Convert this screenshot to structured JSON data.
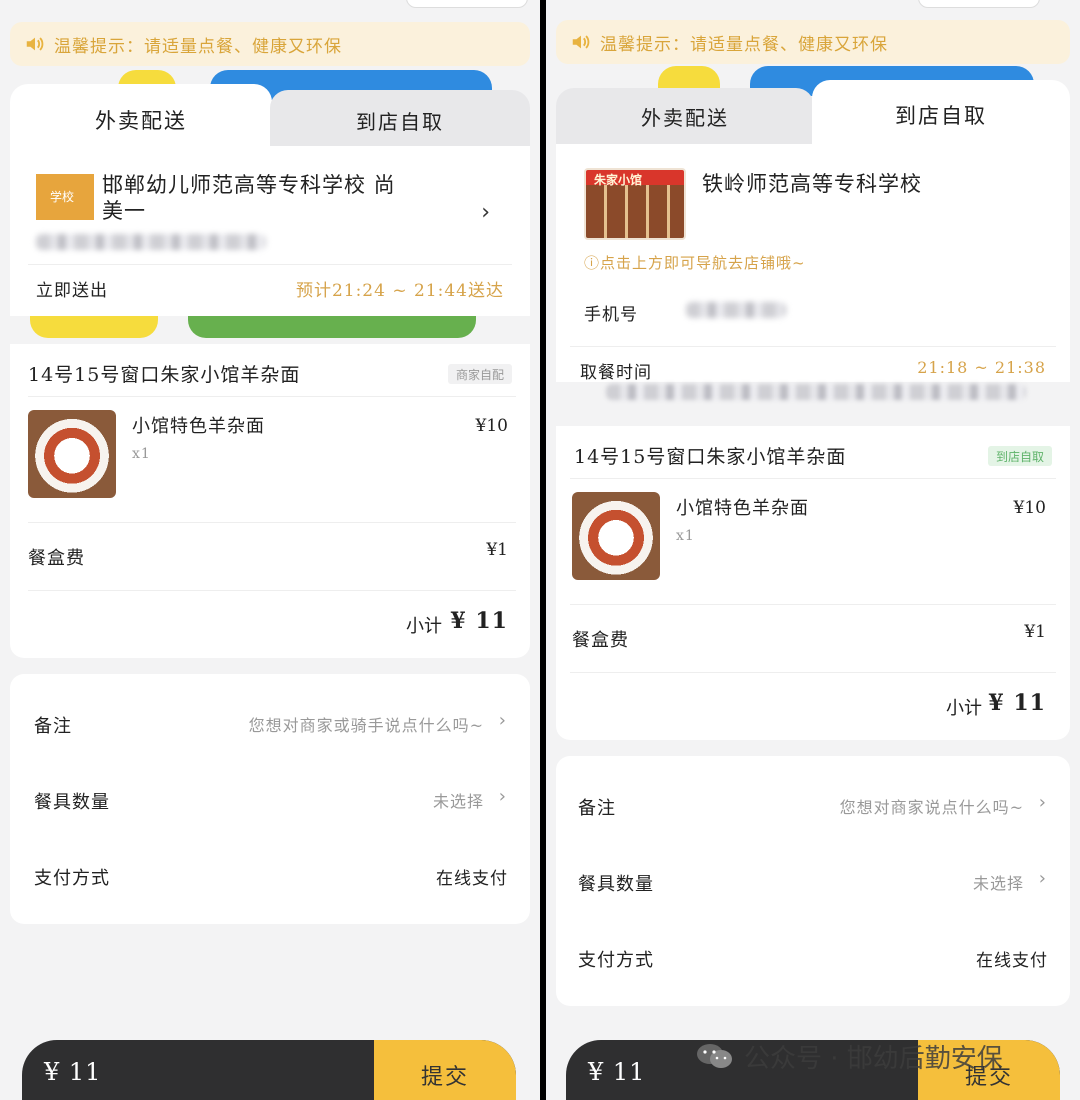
{
  "notice": {
    "text": "温馨提示：请适量点餐、健康又环保"
  },
  "left": {
    "tabs": {
      "delivery": "外卖配送",
      "pickup": "到店自取"
    },
    "address": {
      "badge": "学校",
      "school_line1": "邯郸幼儿师范高等专科学校 尚",
      "school_line2": "美一"
    },
    "delivery": {
      "label": "立即送出",
      "eta": "预计21:24 ~ 21:44送达"
    },
    "shop": {
      "name": "14号15号窗口朱家小馆羊杂面",
      "tag": "商家自配"
    },
    "item": {
      "name": "小馆特色羊杂面",
      "qty": "x1",
      "price": "¥10"
    },
    "box_fee": {
      "label": "餐盒费",
      "price": "¥1"
    },
    "subtotal": {
      "label": "小计",
      "value": "¥ 11"
    },
    "options": {
      "remark_label": "备注",
      "remark_value": "您想对商家或骑手说点什么吗~",
      "utensils_label": "餐具数量",
      "utensils_value": "未选择",
      "payment_label": "支付方式",
      "payment_value": "在线支付"
    },
    "bottom": {
      "total": "¥ 11",
      "submit": "提交"
    }
  },
  "right": {
    "tabs": {
      "delivery": "外卖配送",
      "pickup": "到店自取"
    },
    "store": {
      "name": "铁岭师范高等专科学校",
      "img_text": "朱家小馆",
      "nav_hint": "点击上方即可导航去店铺哦~"
    },
    "phone": {
      "label": "手机号"
    },
    "pickup_time": {
      "label": "取餐时间",
      "value": "21:18 ~ 21:38"
    },
    "shop": {
      "name": "14号15号窗口朱家小馆羊杂面",
      "tag": "到店自取"
    },
    "item": {
      "name": "小馆特色羊杂面",
      "qty": "x1",
      "price": "¥10"
    },
    "box_fee": {
      "label": "餐盒费",
      "price": "¥1"
    },
    "subtotal": {
      "label": "小计",
      "value": "¥ 11"
    },
    "options": {
      "remark_label": "备注",
      "remark_value": "您想对商家说点什么吗~",
      "utensils_label": "餐具数量",
      "utensils_value": "未选择",
      "payment_label": "支付方式",
      "payment_value": "在线支付"
    },
    "bottom": {
      "total": "¥ 11",
      "submit": "提交"
    }
  },
  "watermark": {
    "text": "公众号 · 邯幼后勤安保"
  },
  "colors": {
    "accent_gold": "#d6a34a",
    "submit_yellow": "#f5bf3c",
    "bar_dark": "#2f2f30",
    "pickup_green": "#5fb36a"
  }
}
